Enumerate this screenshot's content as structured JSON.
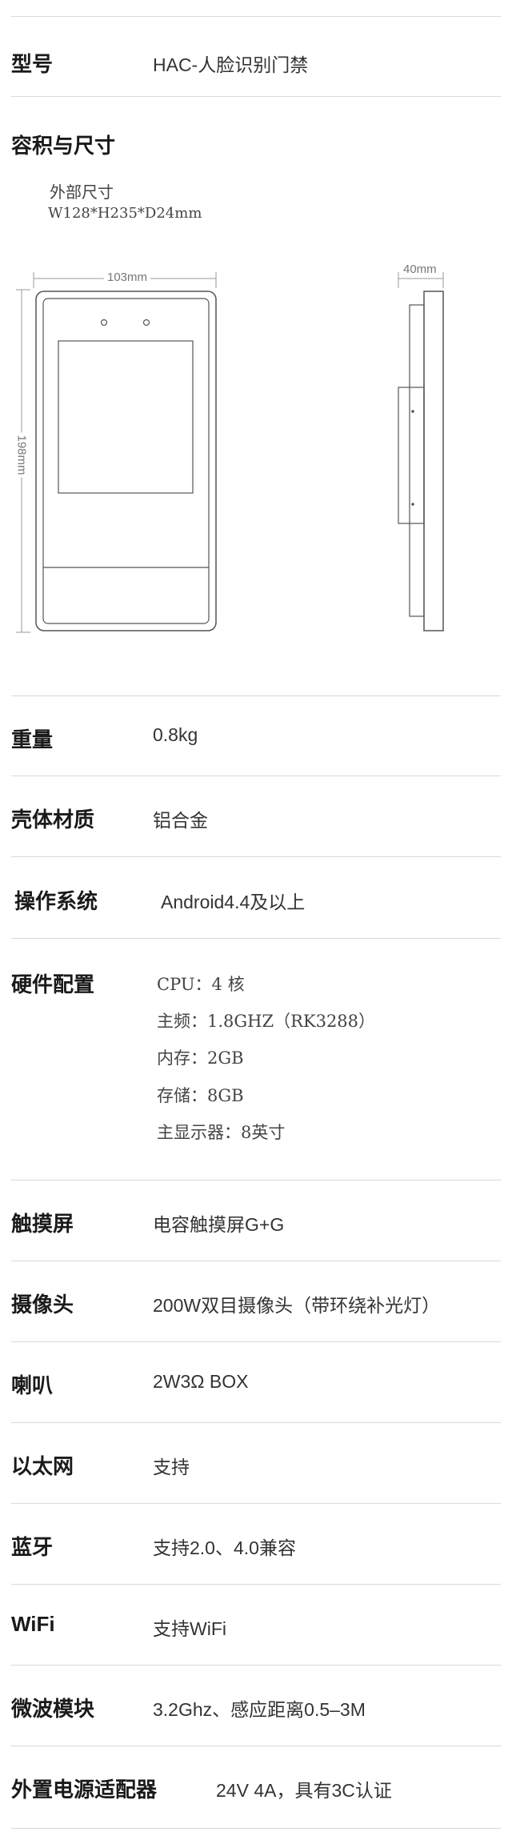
{
  "rows": {
    "model": {
      "label": "型号",
      "value": "HAC-人脸识别门禁"
    },
    "size": {
      "label": "容积与尺寸",
      "subtitle": "外部尺寸",
      "dims": "W128*H235*D24mm",
      "width_text": "103mm",
      "height_text": "198mm",
      "depth_text": "40mm"
    },
    "weight": {
      "label": "重量",
      "value": "0.8kg"
    },
    "material": {
      "label": "壳体材质",
      "value": "铝合金"
    },
    "os": {
      "label": "操作系统",
      "value": "Android4.4及以上"
    },
    "hardware": {
      "label": "硬件配置",
      "items": [
        "CPU：4 核",
        "主频：1.8GHZ（RK3288）",
        "内存：2GB",
        "存储：8GB",
        "主显示器：8英寸"
      ]
    },
    "touch": {
      "label": "触摸屏",
      "value": "电容触摸屏G+G"
    },
    "camera": {
      "label": "摄像头",
      "value": "200W双目摄像头（带环绕补光灯）"
    },
    "speaker": {
      "label": "喇叭",
      "value": "2W3Ω BOX"
    },
    "ethernet": {
      "label": "以太网",
      "value": "支持"
    },
    "bluetooth": {
      "label": "蓝牙",
      "value": "支持2.0、4.0兼容"
    },
    "wifi": {
      "label": "WiFi",
      "value": "支持WiFi"
    },
    "microwave": {
      "label": "微波模块",
      "value": "3.2Ghz、感应距离0.5–3M"
    },
    "power": {
      "label": "外置电源适配器",
      "value": "24V 4A，具有3C认证"
    }
  }
}
